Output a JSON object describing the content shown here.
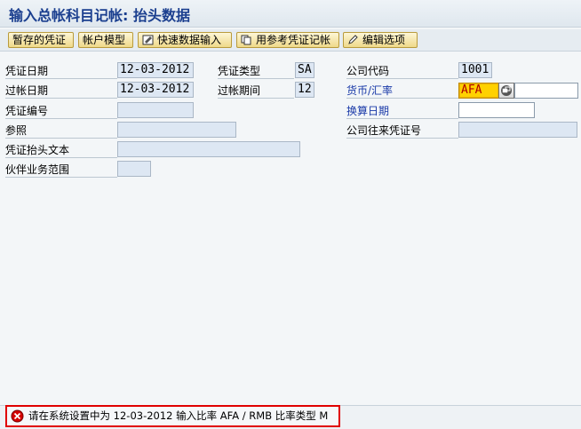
{
  "window": {
    "title": "输入总帐科目记帐: 抬头数据"
  },
  "toolbar": {
    "parked_doc": "暂存的凭证",
    "account_model": "帐户模型",
    "fast_entry": "快速数据输入",
    "post_with_ref": "用参考凭证记帐",
    "editing_options": "编辑选项"
  },
  "form": {
    "doc_date_label": "凭证日期",
    "doc_date": "12-03-2012",
    "doc_type_label": "凭证类型",
    "doc_type": "SA",
    "company_code_label": "公司代码",
    "company_code": "1001",
    "posting_date_label": "过帐日期",
    "posting_date": "12-03-2012",
    "period_label": "过帐期间",
    "period": "12",
    "currency_label": "货币/汇率",
    "currency": "AFA",
    "exchange_rate": "",
    "doc_number_label": "凭证编号",
    "doc_number": "",
    "translation_date_label": "换算日期",
    "translation_date": "",
    "reference_label": "参照",
    "reference": "",
    "cross_cc_label": "公司往来凭证号",
    "cross_cc": "",
    "header_text_label": "凭证抬头文本",
    "header_text": "",
    "trading_partner_label": "伙伴业务范围",
    "trading_partner": ""
  },
  "status": {
    "message": "请在系统设置中为 12-03-2012 输入比率 AFA / RMB 比率类型 M",
    "colors": {
      "error": "#e00000"
    }
  }
}
